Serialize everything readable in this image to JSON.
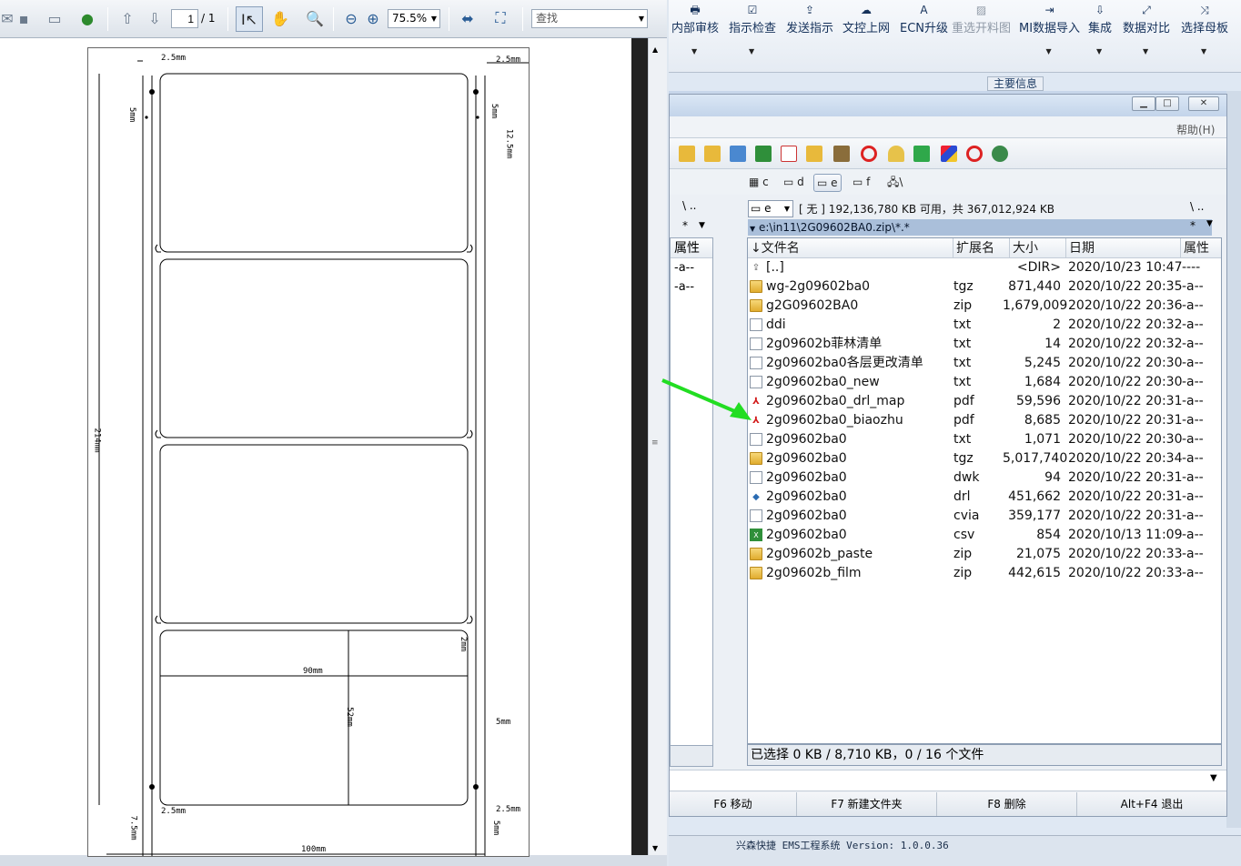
{
  "pdf_viewer": {
    "page_current": "1",
    "page_total": "/ 1",
    "zoom": "75.5%",
    "find_placeholder": "查找",
    "dimensions": [
      "2.5mm",
      "2.5mm",
      "5mm",
      "5mm",
      "12.5mm",
      "214mm",
      "90mm",
      "52mm",
      "5mm",
      "2mm",
      "2.5mm",
      "2.5mm",
      "7.5mm",
      "5mm",
      "100mm"
    ]
  },
  "ems": {
    "ribbon_items": [
      {
        "label": "内部审核",
        "icon": "printer-icon",
        "enabled": true
      },
      {
        "label": "指示检查",
        "icon": "check-icon",
        "enabled": true
      },
      {
        "label": "发送指示",
        "icon": "upload-icon",
        "enabled": true
      },
      {
        "label": "文控上网",
        "icon": "cloud-upload-icon",
        "enabled": true
      },
      {
        "label": "ECN升级",
        "icon": "ecn-icon",
        "enabled": true
      },
      {
        "label": "重选开料图",
        "icon": "image-icon",
        "enabled": false
      },
      {
        "label": "MI数据导入",
        "icon": "import-icon",
        "enabled": true
      },
      {
        "label": "集成",
        "icon": "download-icon",
        "enabled": true
      },
      {
        "label": "数据对比",
        "icon": "compare-icon",
        "enabled": true
      },
      {
        "label": "选择母板",
        "icon": "shuffle-icon",
        "enabled": true
      }
    ],
    "group_label": "主要信息",
    "status_text": "兴森快捷 EMS工程系统 Version: 1.0.0.36"
  },
  "tc": {
    "menu_help": "帮助(H)",
    "drives": [
      "c",
      "d",
      "e",
      "f",
      "\\"
    ],
    "selected_drive": "e",
    "left_pane": {
      "path": "\\  ..",
      "filter": "*",
      "attr_header": "属性",
      "rows": [
        "-a--",
        "-a--"
      ]
    },
    "right_pane": {
      "drive": "e",
      "free_info": "[ 无 ]  192,136,780 KB 可用，共 367,012,924 KB",
      "nav": "\\  ..",
      "path": "e:\\in11\\2G09602BA0.zip\\*.*",
      "filter": "*",
      "columns": {
        "name": "文件名",
        "ext": "扩展名",
        "size": "大小",
        "date": "日期",
        "attr": "属性"
      },
      "files": [
        {
          "icon": "up",
          "name": "[..]",
          "ext": "",
          "size": "<DIR>",
          "date": "2020/10/23 10:47",
          "attr": "----"
        },
        {
          "icon": "folder",
          "name": "wg-2g09602ba0",
          "ext": "tgz",
          "size": "871,440",
          "date": "2020/10/22 20:35",
          "attr": "-a--"
        },
        {
          "icon": "folder",
          "name": "g2G09602BA0",
          "ext": "zip",
          "size": "1,679,009",
          "date": "2020/10/22 20:36",
          "attr": "-a--"
        },
        {
          "icon": "txt",
          "name": "ddi",
          "ext": "txt",
          "size": "2",
          "date": "2020/10/22 20:32",
          "attr": "-a--"
        },
        {
          "icon": "txt",
          "name": "2g09602b菲林清单",
          "ext": "txt",
          "size": "14",
          "date": "2020/10/22 20:32",
          "attr": "-a--"
        },
        {
          "icon": "txt",
          "name": "2g09602ba0各层更改清单",
          "ext": "txt",
          "size": "5,245",
          "date": "2020/10/22 20:30",
          "attr": "-a--"
        },
        {
          "icon": "txt",
          "name": "2g09602ba0_new",
          "ext": "txt",
          "size": "1,684",
          "date": "2020/10/22 20:30",
          "attr": "-a--"
        },
        {
          "icon": "pdf",
          "name": "2g09602ba0_drl_map",
          "ext": "pdf",
          "size": "59,596",
          "date": "2020/10/22 20:31",
          "attr": "-a--"
        },
        {
          "icon": "pdf",
          "name": "2g09602ba0_biaozhu",
          "ext": "pdf",
          "size": "8,685",
          "date": "2020/10/22 20:31",
          "attr": "-a--"
        },
        {
          "icon": "txt",
          "name": "2g09602ba0",
          "ext": "txt",
          "size": "1,071",
          "date": "2020/10/22 20:30",
          "attr": "-a--"
        },
        {
          "icon": "folder",
          "name": "2g09602ba0",
          "ext": "tgz",
          "size": "5,017,740",
          "date": "2020/10/22 20:34",
          "attr": "-a--"
        },
        {
          "icon": "txt",
          "name": "2g09602ba0",
          "ext": "dwk",
          "size": "94",
          "date": "2020/10/22 20:31",
          "attr": "-a--"
        },
        {
          "icon": "drl",
          "name": "2g09602ba0",
          "ext": "drl",
          "size": "451,662",
          "date": "2020/10/22 20:31",
          "attr": "-a--"
        },
        {
          "icon": "txt",
          "name": "2g09602ba0",
          "ext": "cvia",
          "size": "359,177",
          "date": "2020/10/22 20:31",
          "attr": "-a--"
        },
        {
          "icon": "csv",
          "name": "2g09602ba0",
          "ext": "csv",
          "size": "854",
          "date": "2020/10/13 11:09",
          "attr": "-a--"
        },
        {
          "icon": "folder",
          "name": "2g09602b_paste",
          "ext": "zip",
          "size": "21,075",
          "date": "2020/10/22 20:33",
          "attr": "-a--"
        },
        {
          "icon": "folder",
          "name": "2g09602b_film",
          "ext": "zip",
          "size": "442,615",
          "date": "2020/10/22 20:33",
          "attr": "-a--"
        }
      ],
      "selection_info": "已选择 0 KB / 8,710 KB，0 / 16 个文件"
    },
    "function_keys": [
      "F6 移动",
      "F7 新建文件夹",
      "F8 删除",
      "Alt+F4 退出"
    ]
  },
  "colors": {
    "arrow": "#22dd22",
    "path_bar": "#aabfda",
    "ems_text": "#15315a"
  }
}
